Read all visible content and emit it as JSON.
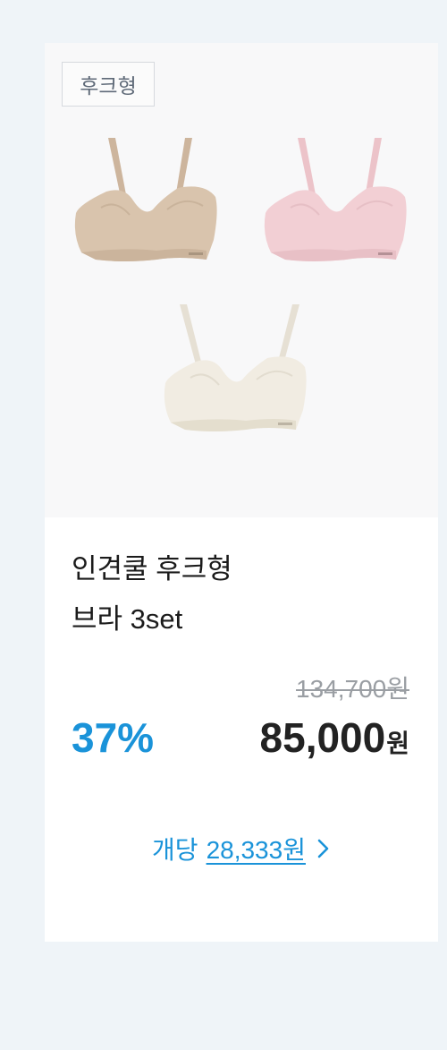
{
  "product": {
    "tag": "후크형",
    "images": [
      {
        "name": "beige-bra",
        "color": "#d9c4ad"
      },
      {
        "name": "pink-bra",
        "color": "#f2cfd4"
      },
      {
        "name": "ivory-bra",
        "color": "#f1ece2"
      }
    ],
    "title_line1": "인견쿨 후크형",
    "title_line2": "브라 3set",
    "original_price": "134,700원",
    "discount": "37%",
    "price": "85,000",
    "price_unit": "원",
    "per_unit_label": "개당",
    "per_unit_price": "28,333원",
    "per_unit_icon": "chevron-right-icon"
  },
  "colors": {
    "background": "#eff4f8",
    "accent": "#1a93d9",
    "price_text": "#222222",
    "strikethrough_price": "#9a9ea3"
  }
}
